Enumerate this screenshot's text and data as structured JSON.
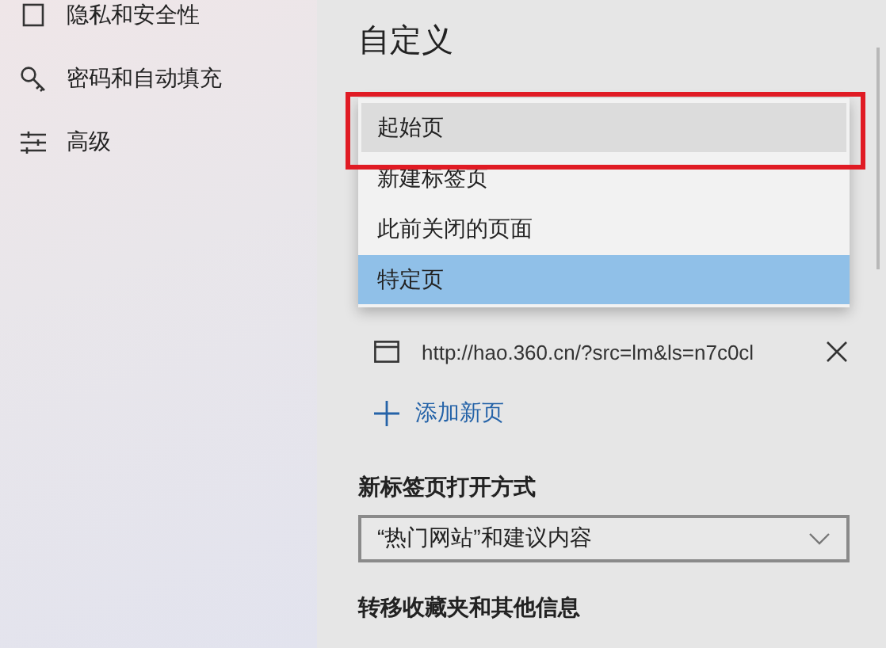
{
  "sidebar": {
    "items": [
      {
        "label": "隐私和安全性",
        "kind": "lock"
      },
      {
        "label": "密码和自动填充",
        "kind": "key"
      },
      {
        "label": "高级",
        "kind": "sliders"
      }
    ]
  },
  "main": {
    "title": "自定义",
    "dropdown": {
      "options": [
        {
          "label": "起始页",
          "selected": false,
          "hovered": true,
          "highlighted": true
        },
        {
          "label": "新建标签页",
          "selected": false,
          "hovered": false,
          "highlighted": false
        },
        {
          "label": "此前关闭的页面",
          "selected": false,
          "hovered": false,
          "highlighted": false
        },
        {
          "label": "特定页",
          "selected": true,
          "hovered": false,
          "highlighted": false
        }
      ]
    },
    "pages": [
      {
        "url": "http://hao.360.cn/?src=lm&ls=n7c0cl"
      }
    ],
    "add_page": "添加新页",
    "new_tab_section": {
      "heading": "新标签页打开方式",
      "value": "“热门网站”和建议内容"
    },
    "transfer_heading": "转移收藏夹和其他信息"
  }
}
